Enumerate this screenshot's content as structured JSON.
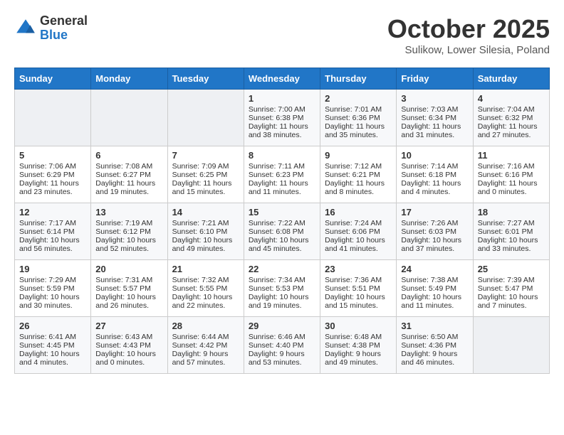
{
  "logo": {
    "general": "General",
    "blue": "Blue"
  },
  "title": "October 2025",
  "subtitle": "Sulikow, Lower Silesia, Poland",
  "days": [
    "Sunday",
    "Monday",
    "Tuesday",
    "Wednesday",
    "Thursday",
    "Friday",
    "Saturday"
  ],
  "weeks": [
    [
      {
        "day": "",
        "info": ""
      },
      {
        "day": "",
        "info": ""
      },
      {
        "day": "",
        "info": ""
      },
      {
        "day": "1",
        "info": "Sunrise: 7:00 AM\nSunset: 6:38 PM\nDaylight: 11 hours\nand 38 minutes."
      },
      {
        "day": "2",
        "info": "Sunrise: 7:01 AM\nSunset: 6:36 PM\nDaylight: 11 hours\nand 35 minutes."
      },
      {
        "day": "3",
        "info": "Sunrise: 7:03 AM\nSunset: 6:34 PM\nDaylight: 11 hours\nand 31 minutes."
      },
      {
        "day": "4",
        "info": "Sunrise: 7:04 AM\nSunset: 6:32 PM\nDaylight: 11 hours\nand 27 minutes."
      }
    ],
    [
      {
        "day": "5",
        "info": "Sunrise: 7:06 AM\nSunset: 6:29 PM\nDaylight: 11 hours\nand 23 minutes."
      },
      {
        "day": "6",
        "info": "Sunrise: 7:08 AM\nSunset: 6:27 PM\nDaylight: 11 hours\nand 19 minutes."
      },
      {
        "day": "7",
        "info": "Sunrise: 7:09 AM\nSunset: 6:25 PM\nDaylight: 11 hours\nand 15 minutes."
      },
      {
        "day": "8",
        "info": "Sunrise: 7:11 AM\nSunset: 6:23 PM\nDaylight: 11 hours\nand 11 minutes."
      },
      {
        "day": "9",
        "info": "Sunrise: 7:12 AM\nSunset: 6:21 PM\nDaylight: 11 hours\nand 8 minutes."
      },
      {
        "day": "10",
        "info": "Sunrise: 7:14 AM\nSunset: 6:18 PM\nDaylight: 11 hours\nand 4 minutes."
      },
      {
        "day": "11",
        "info": "Sunrise: 7:16 AM\nSunset: 6:16 PM\nDaylight: 11 hours\nand 0 minutes."
      }
    ],
    [
      {
        "day": "12",
        "info": "Sunrise: 7:17 AM\nSunset: 6:14 PM\nDaylight: 10 hours\nand 56 minutes."
      },
      {
        "day": "13",
        "info": "Sunrise: 7:19 AM\nSunset: 6:12 PM\nDaylight: 10 hours\nand 52 minutes."
      },
      {
        "day": "14",
        "info": "Sunrise: 7:21 AM\nSunset: 6:10 PM\nDaylight: 10 hours\nand 49 minutes."
      },
      {
        "day": "15",
        "info": "Sunrise: 7:22 AM\nSunset: 6:08 PM\nDaylight: 10 hours\nand 45 minutes."
      },
      {
        "day": "16",
        "info": "Sunrise: 7:24 AM\nSunset: 6:06 PM\nDaylight: 10 hours\nand 41 minutes."
      },
      {
        "day": "17",
        "info": "Sunrise: 7:26 AM\nSunset: 6:03 PM\nDaylight: 10 hours\nand 37 minutes."
      },
      {
        "day": "18",
        "info": "Sunrise: 7:27 AM\nSunset: 6:01 PM\nDaylight: 10 hours\nand 33 minutes."
      }
    ],
    [
      {
        "day": "19",
        "info": "Sunrise: 7:29 AM\nSunset: 5:59 PM\nDaylight: 10 hours\nand 30 minutes."
      },
      {
        "day": "20",
        "info": "Sunrise: 7:31 AM\nSunset: 5:57 PM\nDaylight: 10 hours\nand 26 minutes."
      },
      {
        "day": "21",
        "info": "Sunrise: 7:32 AM\nSunset: 5:55 PM\nDaylight: 10 hours\nand 22 minutes."
      },
      {
        "day": "22",
        "info": "Sunrise: 7:34 AM\nSunset: 5:53 PM\nDaylight: 10 hours\nand 19 minutes."
      },
      {
        "day": "23",
        "info": "Sunrise: 7:36 AM\nSunset: 5:51 PM\nDaylight: 10 hours\nand 15 minutes."
      },
      {
        "day": "24",
        "info": "Sunrise: 7:38 AM\nSunset: 5:49 PM\nDaylight: 10 hours\nand 11 minutes."
      },
      {
        "day": "25",
        "info": "Sunrise: 7:39 AM\nSunset: 5:47 PM\nDaylight: 10 hours\nand 7 minutes."
      }
    ],
    [
      {
        "day": "26",
        "info": "Sunrise: 6:41 AM\nSunset: 4:45 PM\nDaylight: 10 hours\nand 4 minutes."
      },
      {
        "day": "27",
        "info": "Sunrise: 6:43 AM\nSunset: 4:43 PM\nDaylight: 10 hours\nand 0 minutes."
      },
      {
        "day": "28",
        "info": "Sunrise: 6:44 AM\nSunset: 4:42 PM\nDaylight: 9 hours\nand 57 minutes."
      },
      {
        "day": "29",
        "info": "Sunrise: 6:46 AM\nSunset: 4:40 PM\nDaylight: 9 hours\nand 53 minutes."
      },
      {
        "day": "30",
        "info": "Sunrise: 6:48 AM\nSunset: 4:38 PM\nDaylight: 9 hours\nand 49 minutes."
      },
      {
        "day": "31",
        "info": "Sunrise: 6:50 AM\nSunset: 4:36 PM\nDaylight: 9 hours\nand 46 minutes."
      },
      {
        "day": "",
        "info": ""
      }
    ]
  ]
}
